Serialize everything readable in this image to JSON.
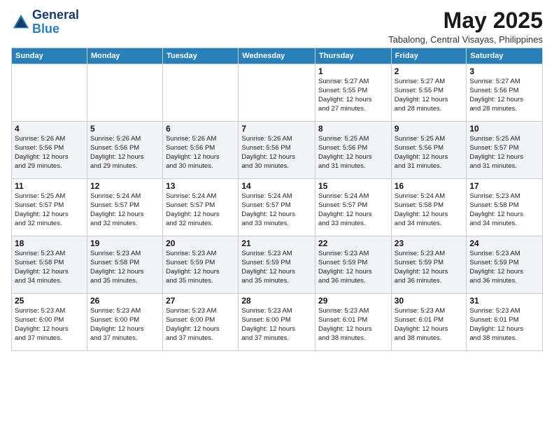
{
  "header": {
    "logo_general": "General",
    "logo_blue": "Blue",
    "month_title": "May 2025",
    "subtitle": "Tabalong, Central Visayas, Philippines"
  },
  "days_of_week": [
    "Sunday",
    "Monday",
    "Tuesday",
    "Wednesday",
    "Thursday",
    "Friday",
    "Saturday"
  ],
  "weeks": [
    [
      {
        "day": "",
        "info": ""
      },
      {
        "day": "",
        "info": ""
      },
      {
        "day": "",
        "info": ""
      },
      {
        "day": "",
        "info": ""
      },
      {
        "day": "1",
        "info": "Sunrise: 5:27 AM\nSunset: 5:55 PM\nDaylight: 12 hours\nand 27 minutes."
      },
      {
        "day": "2",
        "info": "Sunrise: 5:27 AM\nSunset: 5:55 PM\nDaylight: 12 hours\nand 28 minutes."
      },
      {
        "day": "3",
        "info": "Sunrise: 5:27 AM\nSunset: 5:56 PM\nDaylight: 12 hours\nand 28 minutes."
      }
    ],
    [
      {
        "day": "4",
        "info": "Sunrise: 5:26 AM\nSunset: 5:56 PM\nDaylight: 12 hours\nand 29 minutes."
      },
      {
        "day": "5",
        "info": "Sunrise: 5:26 AM\nSunset: 5:56 PM\nDaylight: 12 hours\nand 29 minutes."
      },
      {
        "day": "6",
        "info": "Sunrise: 5:26 AM\nSunset: 5:56 PM\nDaylight: 12 hours\nand 30 minutes."
      },
      {
        "day": "7",
        "info": "Sunrise: 5:26 AM\nSunset: 5:56 PM\nDaylight: 12 hours\nand 30 minutes."
      },
      {
        "day": "8",
        "info": "Sunrise: 5:25 AM\nSunset: 5:56 PM\nDaylight: 12 hours\nand 31 minutes."
      },
      {
        "day": "9",
        "info": "Sunrise: 5:25 AM\nSunset: 5:56 PM\nDaylight: 12 hours\nand 31 minutes."
      },
      {
        "day": "10",
        "info": "Sunrise: 5:25 AM\nSunset: 5:57 PM\nDaylight: 12 hours\nand 31 minutes."
      }
    ],
    [
      {
        "day": "11",
        "info": "Sunrise: 5:25 AM\nSunset: 5:57 PM\nDaylight: 12 hours\nand 32 minutes."
      },
      {
        "day": "12",
        "info": "Sunrise: 5:24 AM\nSunset: 5:57 PM\nDaylight: 12 hours\nand 32 minutes."
      },
      {
        "day": "13",
        "info": "Sunrise: 5:24 AM\nSunset: 5:57 PM\nDaylight: 12 hours\nand 32 minutes."
      },
      {
        "day": "14",
        "info": "Sunrise: 5:24 AM\nSunset: 5:57 PM\nDaylight: 12 hours\nand 33 minutes."
      },
      {
        "day": "15",
        "info": "Sunrise: 5:24 AM\nSunset: 5:57 PM\nDaylight: 12 hours\nand 33 minutes."
      },
      {
        "day": "16",
        "info": "Sunrise: 5:24 AM\nSunset: 5:58 PM\nDaylight: 12 hours\nand 34 minutes."
      },
      {
        "day": "17",
        "info": "Sunrise: 5:23 AM\nSunset: 5:58 PM\nDaylight: 12 hours\nand 34 minutes."
      }
    ],
    [
      {
        "day": "18",
        "info": "Sunrise: 5:23 AM\nSunset: 5:58 PM\nDaylight: 12 hours\nand 34 minutes."
      },
      {
        "day": "19",
        "info": "Sunrise: 5:23 AM\nSunset: 5:58 PM\nDaylight: 12 hours\nand 35 minutes."
      },
      {
        "day": "20",
        "info": "Sunrise: 5:23 AM\nSunset: 5:59 PM\nDaylight: 12 hours\nand 35 minutes."
      },
      {
        "day": "21",
        "info": "Sunrise: 5:23 AM\nSunset: 5:59 PM\nDaylight: 12 hours\nand 35 minutes."
      },
      {
        "day": "22",
        "info": "Sunrise: 5:23 AM\nSunset: 5:59 PM\nDaylight: 12 hours\nand 36 minutes."
      },
      {
        "day": "23",
        "info": "Sunrise: 5:23 AM\nSunset: 5:59 PM\nDaylight: 12 hours\nand 36 minutes."
      },
      {
        "day": "24",
        "info": "Sunrise: 5:23 AM\nSunset: 5:59 PM\nDaylight: 12 hours\nand 36 minutes."
      }
    ],
    [
      {
        "day": "25",
        "info": "Sunrise: 5:23 AM\nSunset: 6:00 PM\nDaylight: 12 hours\nand 37 minutes."
      },
      {
        "day": "26",
        "info": "Sunrise: 5:23 AM\nSunset: 6:00 PM\nDaylight: 12 hours\nand 37 minutes."
      },
      {
        "day": "27",
        "info": "Sunrise: 5:23 AM\nSunset: 6:00 PM\nDaylight: 12 hours\nand 37 minutes."
      },
      {
        "day": "28",
        "info": "Sunrise: 5:23 AM\nSunset: 6:00 PM\nDaylight: 12 hours\nand 37 minutes."
      },
      {
        "day": "29",
        "info": "Sunrise: 5:23 AM\nSunset: 6:01 PM\nDaylight: 12 hours\nand 38 minutes."
      },
      {
        "day": "30",
        "info": "Sunrise: 5:23 AM\nSunset: 6:01 PM\nDaylight: 12 hours\nand 38 minutes."
      },
      {
        "day": "31",
        "info": "Sunrise: 5:23 AM\nSunset: 6:01 PM\nDaylight: 12 hours\nand 38 minutes."
      }
    ]
  ]
}
